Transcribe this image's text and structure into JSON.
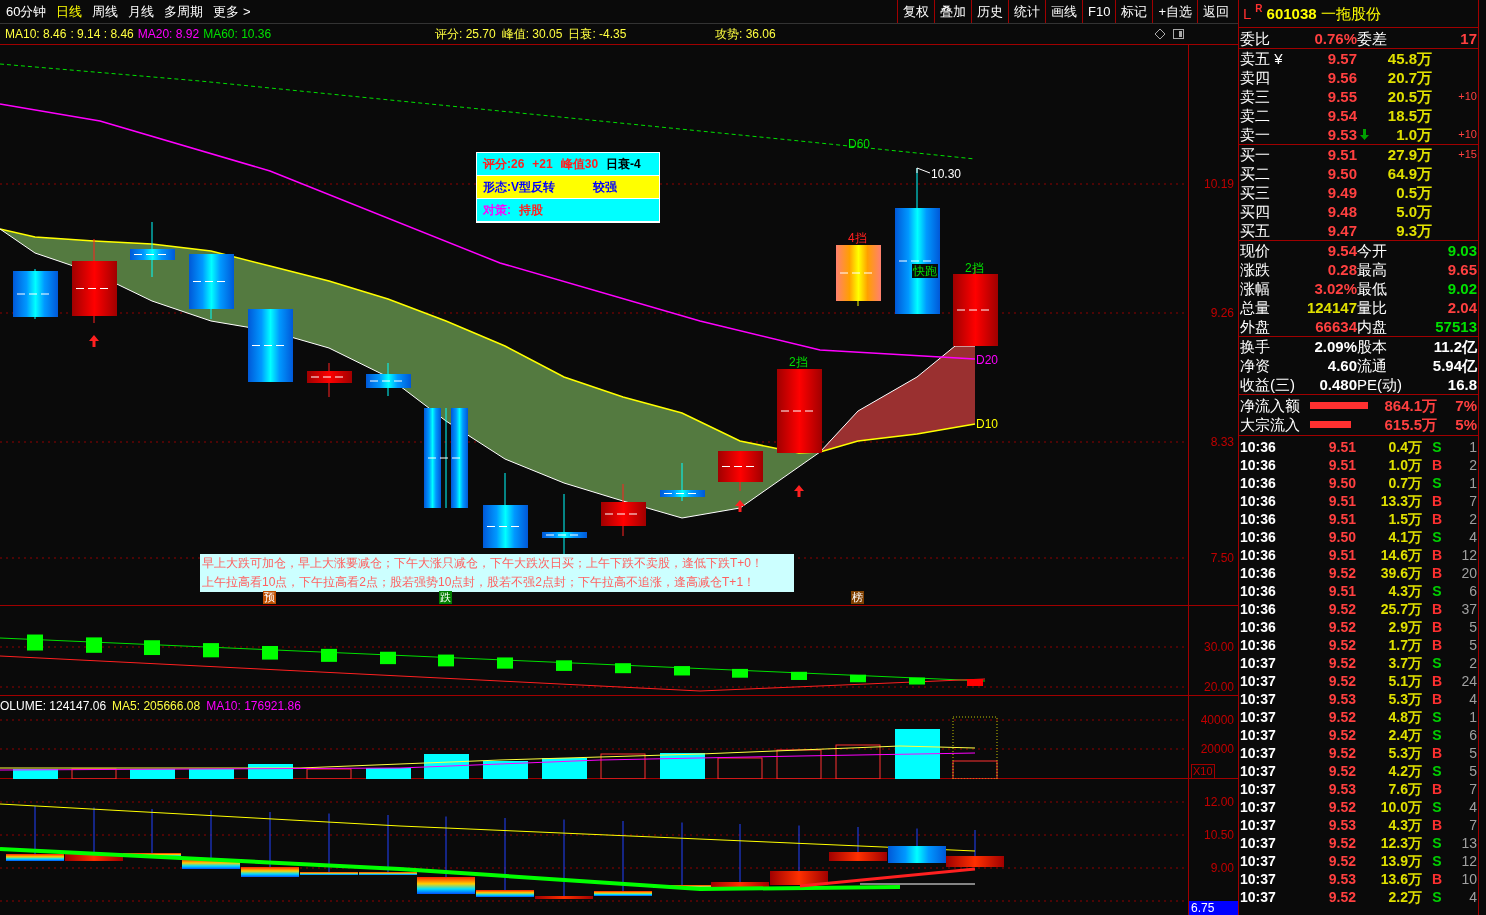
{
  "top_bar": {
    "periods": [
      {
        "label": "60分钟",
        "selected": false
      },
      {
        "label": "日线",
        "selected": true
      },
      {
        "label": "周线",
        "selected": false
      },
      {
        "label": "月线",
        "selected": false
      },
      {
        "label": "多周期",
        "selected": false
      },
      {
        "label": "更多 >",
        "selected": false
      }
    ],
    "buttons": [
      "复权",
      "叠加",
      "历史",
      "统计",
      "画线",
      "F10",
      "标记",
      "+自选",
      "返回"
    ]
  },
  "legend": {
    "ma": [
      "MA10: 8.46",
      ": 9.14 : 8.46",
      "MA20: 8.92",
      "MA60: 10.36"
    ],
    "scores": [
      "评分: 25.70",
      "峰值: 30.05",
      "日衰: -4.35"
    ],
    "attack": "攻势: 36.06"
  },
  "price_axis": [
    "10.19",
    "9.26",
    "8.33",
    "7.50"
  ],
  "chart_labels": [
    "D60",
    "10.30",
    "4挡",
    "快跑",
    "2挡",
    "2挡",
    "D20",
    "D10"
  ],
  "info_box": [
    {
      "color": "#00ffff",
      "parts": [
        {
          "text": "评分:26",
          "color": "#ff2020"
        },
        {
          "text": "+21",
          "color": "#ff2020"
        },
        {
          "text": "峰值30",
          "color": "#ff2020"
        },
        {
          "text": "日衰-4",
          "color": "#000000"
        }
      ]
    },
    {
      "color": "#ffff00",
      "parts": [
        {
          "text": "形态:V型反转",
          "color": "#0000ff"
        },
        {
          "text": "较强",
          "color": "#0000ff"
        }
      ]
    },
    {
      "color": "#00ffff",
      "parts": [
        {
          "text": "对策:",
          "color": "#ff00ff"
        },
        {
          "text": "持股",
          "color": "#ff2020"
        }
      ]
    }
  ],
  "tips": [
    "早上大跌可加仓，早上大涨要减仓；下午大涨只减仓，下午大跌次日买；上午下跌不卖股，逢低下跌T+0！",
    "上午拉高看10点，下午拉高看2点；股若强势10点封，股若不强2点封；下午拉高不追涨，逢高减仓T+1！"
  ],
  "markers": [
    {
      "text": "预",
      "color": "#c05000"
    },
    {
      "text": "跌",
      "color": "#008000"
    },
    {
      "text": "榜",
      "color": "#804000"
    }
  ],
  "oscillator_axis": [
    "30.00",
    "20.00"
  ],
  "volume": {
    "legend": [
      {
        "text": "OLUME: 124147.06",
        "color": "#ffffff"
      },
      {
        "text": "MA5: 205666.08",
        "color": "#ffff40"
      },
      {
        "text": "MA10: 176921.86",
        "color": "#ff00ff"
      }
    ],
    "axis": [
      "40000",
      "20000"
    ],
    "unit": "X10"
  },
  "indicator_axis": [
    "12.00",
    "10.50",
    "9.00"
  ],
  "indicator_current": "6.75",
  "quote": {
    "marker": "L",
    "flag": "R",
    "code": "601038",
    "name": "一拖股份"
  },
  "committee": [
    {
      "label": "委比",
      "value": "0.76%"
    },
    {
      "label": "委差",
      "value": "17"
    }
  ],
  "asks": [
    {
      "label": "卖五 ¥",
      "price": "9.57",
      "volume": "45.8万",
      "down_arrow": false
    },
    {
      "label": "卖四",
      "price": "9.56",
      "volume": "20.7万",
      "down_arrow": false
    },
    {
      "label": "卖三",
      "price": "9.55",
      "volume": "20.5万",
      "change": "+10",
      "down_arrow": false
    },
    {
      "label": "卖二",
      "price": "9.54",
      "volume": "18.5万",
      "down_arrow": false
    },
    {
      "label": "卖一",
      "price": "9.53",
      "volume": "1.0万",
      "change": "+10",
      "down_arrow": true
    }
  ],
  "bids": [
    {
      "label": "买一",
      "price": "9.51",
      "volume": "27.9万",
      "change": "+15",
      "down_arrow": false
    },
    {
      "label": "买二",
      "price": "9.50",
      "volume": "64.9万",
      "down_arrow": false
    },
    {
      "label": "买三",
      "price": "9.49",
      "volume": "0.5万",
      "down_arrow": false
    },
    {
      "label": "买四",
      "price": "9.48",
      "volume": "5.0万",
      "down_arrow": false
    },
    {
      "label": "买五",
      "price": "9.47",
      "volume": "9.3万",
      "down_arrow": false
    }
  ],
  "stats": [
    [
      {
        "label": "现价",
        "value": "9.54",
        "color": "#ff4040"
      },
      {
        "label": "今开",
        "value": "9.03",
        "color": "#00e000"
      }
    ],
    [
      {
        "label": "涨跌",
        "value": "0.28",
        "color": "#ff4040"
      },
      {
        "label": "最高",
        "value": "9.65",
        "color": "#ff4040"
      }
    ],
    [
      {
        "label": "涨幅",
        "value": "3.02%",
        "color": "#ff4040"
      },
      {
        "label": "最低",
        "value": "9.02",
        "color": "#00e000"
      }
    ],
    [
      {
        "label": "总量",
        "value": "124147",
        "color": "#e0e000"
      },
      {
        "label": "量比",
        "value": "2.04",
        "color": "#ff4040"
      }
    ],
    [
      {
        "label": "外盘",
        "value": "66634",
        "color": "#ff4040"
      },
      {
        "label": "内盘",
        "value": "57513",
        "color": "#00e000"
      }
    ]
  ],
  "fundamentals": [
    [
      {
        "label": "换手",
        "value": "2.09%"
      },
      {
        "label": "股本",
        "value": "11.2亿"
      }
    ],
    [
      {
        "label": "净资",
        "value": "4.60"
      },
      {
        "label": "流通",
        "value": "5.94亿"
      }
    ],
    [
      {
        "label": "收益(三)",
        "value": "0.480"
      },
      {
        "label": "PE(动)",
        "value": "16.8"
      }
    ]
  ],
  "flows": [
    {
      "label": "净流入额",
      "amount": "864.1万",
      "percent": "7%"
    },
    {
      "label": "大宗流入",
      "amount": "615.5万",
      "percent": "5%"
    }
  ],
  "ticks": [
    {
      "time": "10:36",
      "price": "9.51",
      "volume": "0.4万",
      "side": "S",
      "kind": "sell",
      "count": "1"
    },
    {
      "time": "10:36",
      "price": "9.51",
      "volume": "1.0万",
      "side": "B",
      "kind": "buy",
      "count": "2"
    },
    {
      "time": "10:36",
      "price": "9.50",
      "volume": "0.7万",
      "side": "S",
      "kind": "sell",
      "count": "1"
    },
    {
      "time": "10:36",
      "price": "9.51",
      "volume": "13.3万",
      "side": "B",
      "kind": "buy",
      "count": "7"
    },
    {
      "time": "10:36",
      "price": "9.51",
      "volume": "1.5万",
      "side": "B",
      "kind": "buy",
      "count": "2"
    },
    {
      "time": "10:36",
      "price": "9.50",
      "volume": "4.1万",
      "side": "S",
      "kind": "sell",
      "count": "4"
    },
    {
      "time": "10:36",
      "price": "9.51",
      "volume": "14.6万",
      "side": "B",
      "kind": "buy",
      "count": "12"
    },
    {
      "time": "10:36",
      "price": "9.52",
      "volume": "39.6万",
      "side": "B",
      "kind": "buy",
      "count": "20"
    },
    {
      "time": "10:36",
      "price": "9.51",
      "volume": "4.3万",
      "side": "S",
      "kind": "sell",
      "count": "6"
    },
    {
      "time": "10:36",
      "price": "9.52",
      "volume": "25.7万",
      "side": "B",
      "kind": "buy",
      "count": "37"
    },
    {
      "time": "10:36",
      "price": "9.52",
      "volume": "2.9万",
      "side": "B",
      "kind": "buy",
      "count": "5"
    },
    {
      "time": "10:36",
      "price": "9.52",
      "volume": "1.7万",
      "side": "B",
      "kind": "buy",
      "count": "5"
    },
    {
      "time": "10:37",
      "price": "9.52",
      "volume": "3.7万",
      "side": "S",
      "kind": "sell",
      "count": "2"
    },
    {
      "time": "10:37",
      "price": "9.52",
      "volume": "5.1万",
      "side": "B",
      "kind": "buy",
      "count": "24"
    },
    {
      "time": "10:37",
      "price": "9.53",
      "volume": "5.3万",
      "side": "B",
      "kind": "buy",
      "count": "4"
    },
    {
      "time": "10:37",
      "price": "9.52",
      "volume": "4.8万",
      "side": "S",
      "kind": "sell",
      "count": "1"
    },
    {
      "time": "10:37",
      "price": "9.52",
      "volume": "2.4万",
      "side": "S",
      "kind": "sell",
      "count": "6"
    },
    {
      "time": "10:37",
      "price": "9.52",
      "volume": "5.3万",
      "side": "B",
      "kind": "buy",
      "count": "5"
    },
    {
      "time": "10:37",
      "price": "9.52",
      "volume": "4.2万",
      "side": "S",
      "kind": "sell",
      "count": "5"
    },
    {
      "time": "10:37",
      "price": "9.53",
      "volume": "7.6万",
      "side": "B",
      "kind": "buy",
      "count": "7"
    },
    {
      "time": "10:37",
      "price": "9.52",
      "volume": "10.0万",
      "side": "S",
      "kind": "sell",
      "count": "4"
    },
    {
      "time": "10:37",
      "price": "9.53",
      "volume": "4.3万",
      "side": "B",
      "kind": "buy",
      "count": "7"
    },
    {
      "time": "10:37",
      "price": "9.52",
      "volume": "12.3万",
      "side": "S",
      "kind": "sell",
      "count": "13"
    },
    {
      "time": "10:37",
      "price": "9.52",
      "volume": "13.9万",
      "side": "S",
      "kind": "sell",
      "count": "12"
    },
    {
      "time": "10:37",
      "price": "9.53",
      "volume": "13.6万",
      "side": "B",
      "kind": "buy",
      "count": "10"
    },
    {
      "time": "10:37",
      "price": "9.52",
      "volume": "2.2万",
      "side": "S",
      "kind": "sell",
      "count": "4"
    }
  ]
}
